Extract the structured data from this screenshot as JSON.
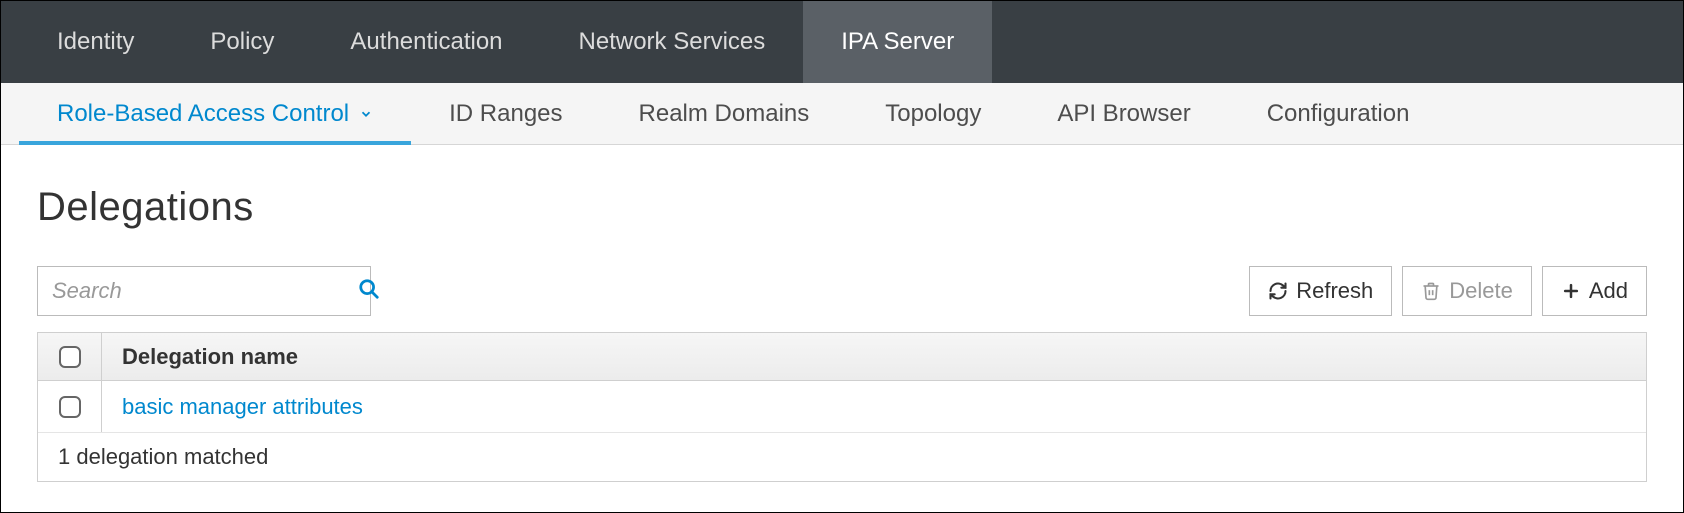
{
  "topnav": {
    "items": [
      {
        "label": "Identity"
      },
      {
        "label": "Policy"
      },
      {
        "label": "Authentication"
      },
      {
        "label": "Network Services"
      },
      {
        "label": "IPA Server",
        "active": true
      }
    ]
  },
  "subnav": {
    "items": [
      {
        "label": "Role-Based Access Control",
        "active": true,
        "dropdown": true
      },
      {
        "label": "ID Ranges"
      },
      {
        "label": "Realm Domains"
      },
      {
        "label": "Topology"
      },
      {
        "label": "API Browser"
      },
      {
        "label": "Configuration"
      }
    ]
  },
  "page": {
    "title": "Delegations"
  },
  "search": {
    "placeholder": "Search"
  },
  "buttons": {
    "refresh": "Refresh",
    "delete": "Delete",
    "add": "Add"
  },
  "table": {
    "header": {
      "col_name": "Delegation name"
    },
    "rows": [
      {
        "name": "basic manager attributes"
      }
    ],
    "footer": "1 delegation matched"
  }
}
